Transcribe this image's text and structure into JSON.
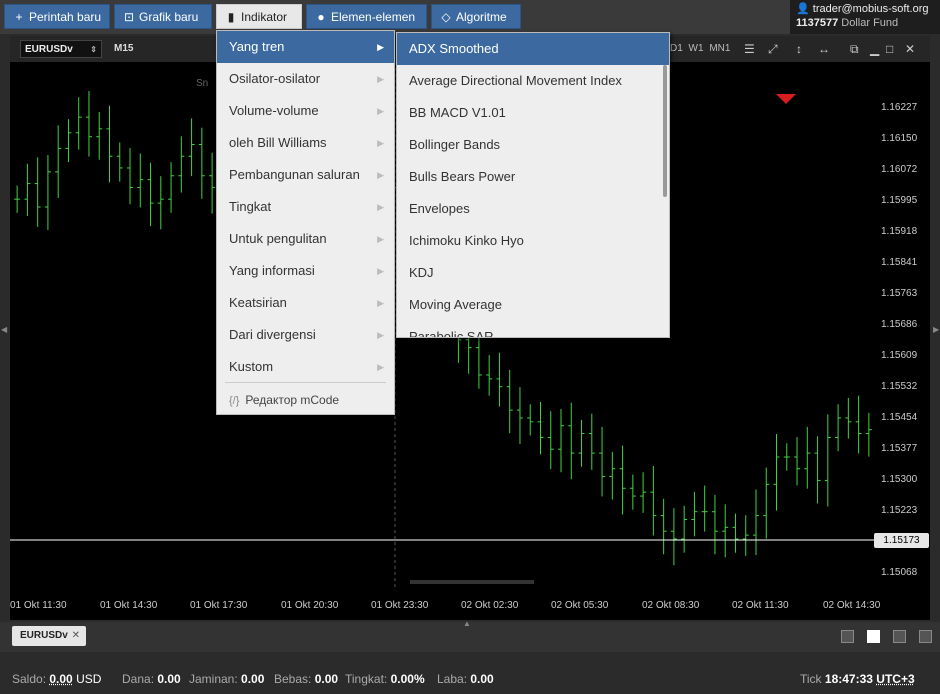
{
  "toolbar": {
    "new_order": "Perintah baru",
    "new_chart": "Grafik baru",
    "indicator": "Indikator",
    "elements": "Elemen-elemen",
    "algorithm": "Algoritme"
  },
  "account": {
    "email": "trader@mobius-soft.org",
    "number": "1137577",
    "fund": "Dollar Fund"
  },
  "chart": {
    "symbol": "EURUSDv",
    "timeframe": "M15",
    "timeframes": "D1 W1 MN1",
    "price_labels": [
      "1.16227",
      "1.16150",
      "1.16072",
      "1.15995",
      "1.15918",
      "1.15841",
      "1.15763",
      "1.15686",
      "1.15609",
      "1.15532",
      "1.15454",
      "1.15377",
      "1.15300",
      "1.15223",
      "1.15068"
    ],
    "current_price": "1.15173",
    "time_labels": [
      "01 Okt 11:30",
      "01 Okt 14:30",
      "01 Okt 17:30",
      "01 Okt 20:30",
      "01 Okt 23:30",
      "02 Okt 02:30",
      "02 Okt 05:30",
      "02 Okt 08:30",
      "02 Okt 11:30",
      "02 Okt 14:30"
    ],
    "session_label": "Sn",
    "candle_color": "#3fd43f"
  },
  "chart_data": {
    "type": "ohlc",
    "symbol": "EURUSDv",
    "timeframe": "M15",
    "x_labels": [
      "01 Okt 11:30",
      "01 Okt 14:30",
      "01 Okt 17:30",
      "01 Okt 20:30",
      "01 Okt 23:30",
      "02 Okt 02:30",
      "02 Okt 05:30",
      "02 Okt 08:30",
      "02 Okt 11:30",
      "02 Okt 14:30"
    ],
    "ylim": [
      1.15,
      1.1628
    ],
    "current_price": 1.15173,
    "series": [
      {
        "name": "close",
        "values": [
          1.1598,
          1.1602,
          1.1596,
          1.1605,
          1.1611,
          1.1615,
          1.1619,
          1.1614,
          1.1616,
          1.1609,
          1.1606,
          1.1601,
          1.1603,
          1.1597,
          1.1598,
          1.1604,
          1.1609,
          1.1612,
          1.1604,
          1.1601,
          1.1609,
          1.1607,
          1.1602,
          1.1606,
          1.1601,
          1.1597,
          1.1596,
          1.1599,
          1.1591,
          1.1603,
          1.1611,
          1.1619,
          1.1611,
          1.1606,
          1.1616,
          1.1608,
          1.1601,
          1.1597,
          1.1593,
          1.1591,
          1.1586,
          1.1584,
          1.1574,
          1.1562,
          1.156,
          1.1553,
          1.1552,
          1.155,
          1.1544,
          1.1542,
          1.1541,
          1.1537,
          1.1534,
          1.154,
          1.1533,
          1.1538,
          1.1533,
          1.1527,
          1.1529,
          1.1524,
          1.1522,
          1.1523,
          1.1517,
          1.1513,
          1.1511,
          1.1516,
          1.1518,
          1.1518,
          1.1513,
          1.1514,
          1.1511,
          1.1512,
          1.1517,
          1.1525,
          1.1532,
          1.1532,
          1.1529,
          1.1533,
          1.1526,
          1.1537,
          1.1542,
          1.1541,
          1.1538,
          1.1539
        ]
      }
    ]
  },
  "menu": {
    "items": [
      {
        "label": "Yang tren"
      },
      {
        "label": "Osilator-osilator"
      },
      {
        "label": "Volume-volume"
      },
      {
        "label": "oleh Bill Williams"
      },
      {
        "label": "Pembangunan saluran"
      },
      {
        "label": "Tingkat"
      },
      {
        "label": "Untuk pengulitan"
      },
      {
        "label": "Yang informasi"
      },
      {
        "label": "Keatsirian"
      },
      {
        "label": "Dari divergensi"
      },
      {
        "label": "Kustom"
      }
    ],
    "mcode": "Редактор mCode"
  },
  "submenu": {
    "items": [
      {
        "label": "ADX Smoothed"
      },
      {
        "label": "Average Directional Movement Index"
      },
      {
        "label": "BB MACD V1.01"
      },
      {
        "label": "Bollinger Bands"
      },
      {
        "label": "Bulls Bears Power"
      },
      {
        "label": "Envelopes"
      },
      {
        "label": "Ichimoku Kinko Hyo"
      },
      {
        "label": "KDJ"
      },
      {
        "label": "Moving Average"
      },
      {
        "label": "Parabolic SAR"
      }
    ]
  },
  "tabs": {
    "symbol_tab": "EURUSDv"
  },
  "status": {
    "balance_label": "Saldo:",
    "balance_value": "0.00",
    "currency": "USD",
    "funds_label": "Dana:",
    "funds_value": "0.00",
    "margin_label": "Jaminan:",
    "margin_value": "0.00",
    "free_label": "Bebas:",
    "free_value": "0.00",
    "level_label": "Tingkat:",
    "level_value": "0.00%",
    "profit_label": "Laba:",
    "profit_value": "0.00",
    "tick_label": "Tick",
    "time": "18:47:33",
    "timezone": "UTC+3"
  }
}
